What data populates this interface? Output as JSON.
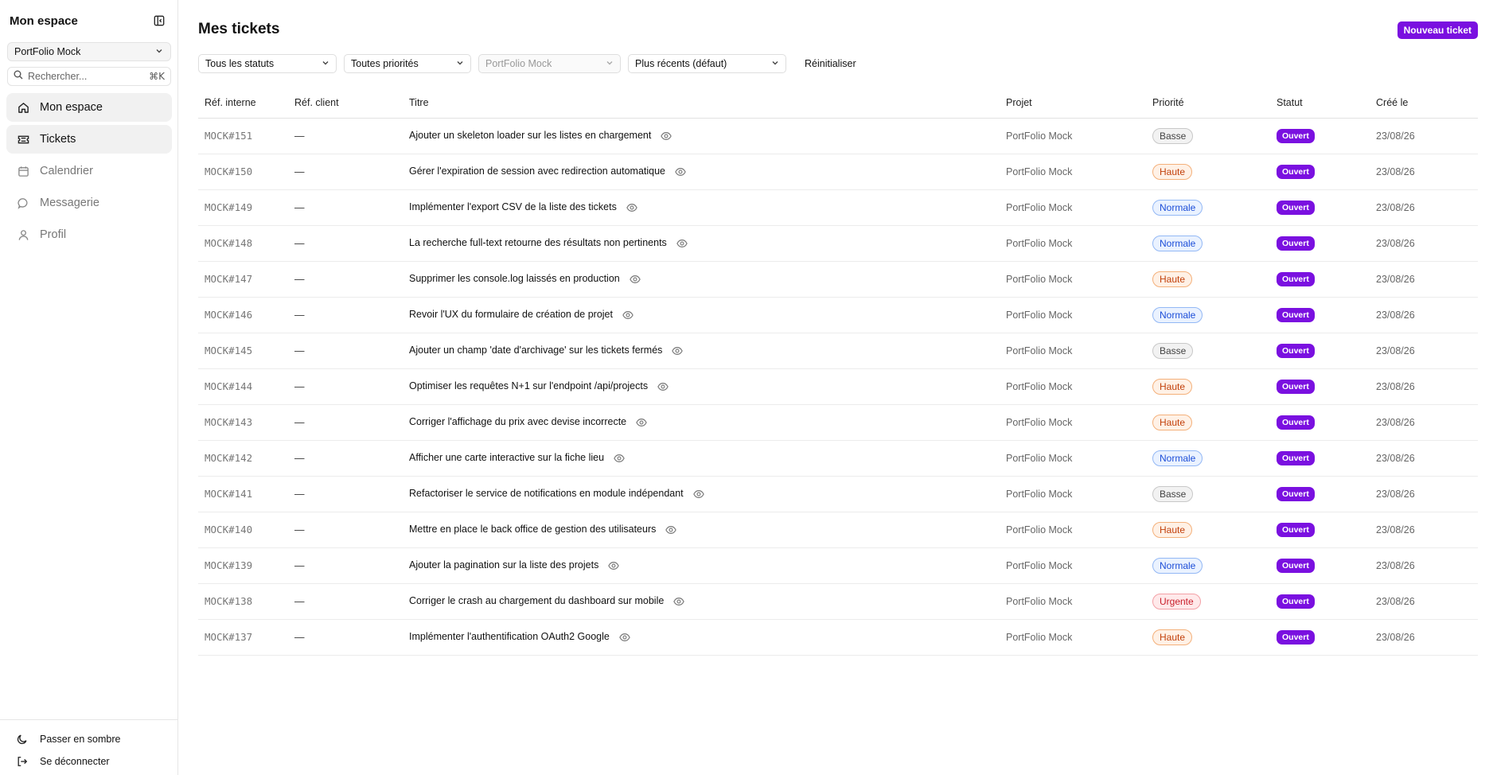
{
  "sidebar": {
    "title": "Mon espace",
    "project_selector": "PortFolio Mock",
    "search": {
      "placeholder": "Rechercher...",
      "shortcut": "⌘K"
    },
    "nav": [
      {
        "label": "Mon espace",
        "icon": "home-icon",
        "active": true
      },
      {
        "label": "Tickets",
        "icon": "ticket-icon",
        "active": true
      },
      {
        "label": "Calendrier",
        "icon": "calendar-icon",
        "active": false
      },
      {
        "label": "Messagerie",
        "icon": "message-icon",
        "active": false
      },
      {
        "label": "Profil",
        "icon": "user-icon",
        "active": false
      }
    ],
    "footer": {
      "dark_mode": "Passer en sombre",
      "logout": "Se déconnecter"
    }
  },
  "header": {
    "title": "Mes tickets",
    "new_ticket": "Nouveau ticket"
  },
  "filters": {
    "status": "Tous les statuts",
    "priority": "Toutes priorités",
    "project": "PortFolio Mock",
    "sort": "Plus récents (défaut)",
    "reset": "Réinitialiser"
  },
  "colors": {
    "accent": "#7a10e0",
    "priority": {
      "Basse": {
        "bg": "#f2f2f2",
        "border": "#c8c8c8",
        "text": "#444444"
      },
      "Haute": {
        "bg": "#fff1e6",
        "border": "#f4b07a",
        "text": "#c2410c"
      },
      "Normale": {
        "bg": "#eaf2ff",
        "border": "#93b8f5",
        "text": "#1d4ed8"
      },
      "Urgente": {
        "bg": "#ffe9ea",
        "border": "#f3a0a6",
        "text": "#c81e2a"
      }
    }
  },
  "table": {
    "columns": [
      "Réf. interne",
      "Réf. client",
      "Titre",
      "Projet",
      "Priorité",
      "Statut",
      "Créé le"
    ],
    "rows": [
      {
        "ref": "MOCK#151",
        "client": "—",
        "title": "Ajouter un skeleton loader sur les listes en chargement",
        "project": "PortFolio Mock",
        "priority": "Basse",
        "status": "Ouvert",
        "created": "23/08/26"
      },
      {
        "ref": "MOCK#150",
        "client": "—",
        "title": "Gérer l'expiration de session avec redirection automatique",
        "project": "PortFolio Mock",
        "priority": "Haute",
        "status": "Ouvert",
        "created": "23/08/26"
      },
      {
        "ref": "MOCK#149",
        "client": "—",
        "title": "Implémenter l'export CSV de la liste des tickets",
        "project": "PortFolio Mock",
        "priority": "Normale",
        "status": "Ouvert",
        "created": "23/08/26"
      },
      {
        "ref": "MOCK#148",
        "client": "—",
        "title": "La recherche full-text retourne des résultats non pertinents",
        "project": "PortFolio Mock",
        "priority": "Normale",
        "status": "Ouvert",
        "created": "23/08/26"
      },
      {
        "ref": "MOCK#147",
        "client": "—",
        "title": "Supprimer les console.log laissés en production",
        "project": "PortFolio Mock",
        "priority": "Haute",
        "status": "Ouvert",
        "created": "23/08/26"
      },
      {
        "ref": "MOCK#146",
        "client": "—",
        "title": "Revoir l'UX du formulaire de création de projet",
        "project": "PortFolio Mock",
        "priority": "Normale",
        "status": "Ouvert",
        "created": "23/08/26"
      },
      {
        "ref": "MOCK#145",
        "client": "—",
        "title": "Ajouter un champ 'date d'archivage' sur les tickets fermés",
        "project": "PortFolio Mock",
        "priority": "Basse",
        "status": "Ouvert",
        "created": "23/08/26"
      },
      {
        "ref": "MOCK#144",
        "client": "—",
        "title": "Optimiser les requêtes N+1 sur l'endpoint /api/projects",
        "project": "PortFolio Mock",
        "priority": "Haute",
        "status": "Ouvert",
        "created": "23/08/26"
      },
      {
        "ref": "MOCK#143",
        "client": "—",
        "title": "Corriger l'affichage du prix avec devise incorrecte",
        "project": "PortFolio Mock",
        "priority": "Haute",
        "status": "Ouvert",
        "created": "23/08/26"
      },
      {
        "ref": "MOCK#142",
        "client": "—",
        "title": "Afficher une carte interactive sur la fiche lieu",
        "project": "PortFolio Mock",
        "priority": "Normale",
        "status": "Ouvert",
        "created": "23/08/26"
      },
      {
        "ref": "MOCK#141",
        "client": "—",
        "title": "Refactoriser le service de notifications en module indépendant",
        "project": "PortFolio Mock",
        "priority": "Basse",
        "status": "Ouvert",
        "created": "23/08/26"
      },
      {
        "ref": "MOCK#140",
        "client": "—",
        "title": "Mettre en place le back office de gestion des utilisateurs",
        "project": "PortFolio Mock",
        "priority": "Haute",
        "status": "Ouvert",
        "created": "23/08/26"
      },
      {
        "ref": "MOCK#139",
        "client": "—",
        "title": "Ajouter la pagination sur la liste des projets",
        "project": "PortFolio Mock",
        "priority": "Normale",
        "status": "Ouvert",
        "created": "23/08/26"
      },
      {
        "ref": "MOCK#138",
        "client": "—",
        "title": "Corriger le crash au chargement du dashboard sur mobile",
        "project": "PortFolio Mock",
        "priority": "Urgente",
        "status": "Ouvert",
        "created": "23/08/26"
      },
      {
        "ref": "MOCK#137",
        "client": "—",
        "title": "Implémenter l'authentification OAuth2 Google",
        "project": "PortFolio Mock",
        "priority": "Haute",
        "status": "Ouvert",
        "created": "23/08/26"
      }
    ]
  }
}
